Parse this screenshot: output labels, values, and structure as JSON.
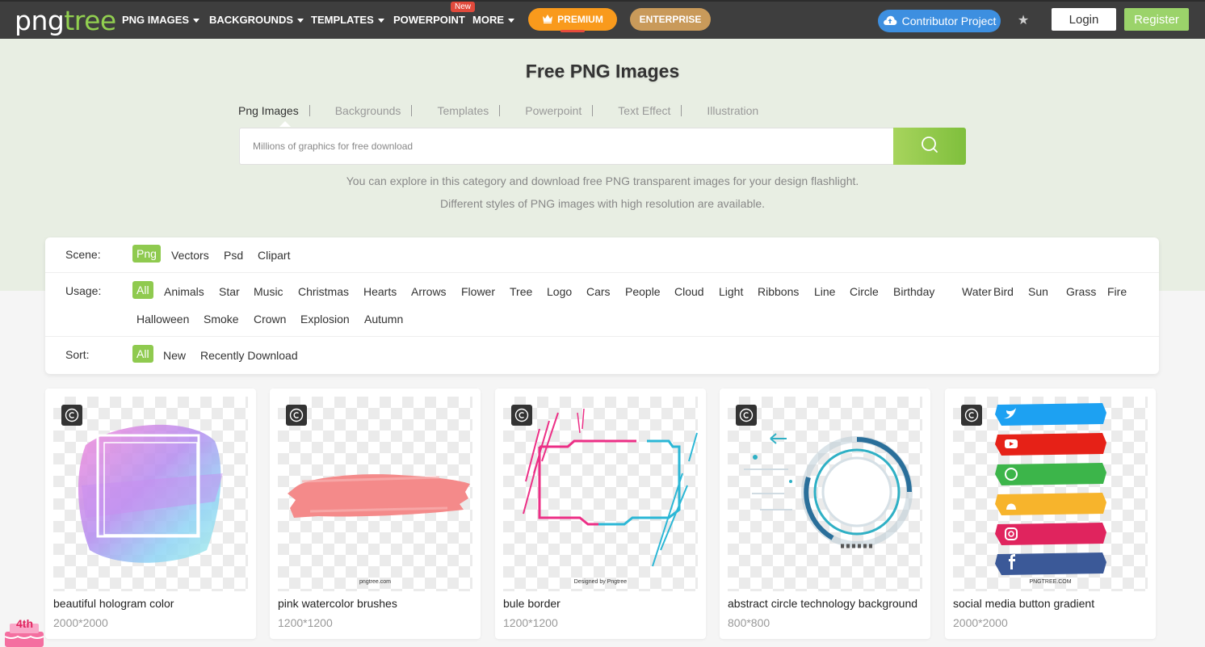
{
  "nav": {
    "logo_png": "png",
    "logo_tree": "tree",
    "items": [
      "PNG IMAGES",
      "BACKGROUNDS",
      "TEMPLATES",
      "POWERPOINT",
      "MORE"
    ],
    "new_badge": "New",
    "premium": "PREMIUM",
    "enterprise": "ENTERPRISE",
    "contributor": "Contributor Project",
    "login": "Login",
    "register": "Register"
  },
  "hero": {
    "title": "Free PNG Images",
    "tabs": [
      "Png Images",
      "Backgrounds",
      "Templates",
      "Powerpoint",
      "Text Effect",
      "Illustration"
    ],
    "search_placeholder": "Millions of graphics for free download",
    "desc1": "You can explore in this category and download free PNG transparent images for your design flashlight.",
    "desc2": "Different styles of PNG images with high resolution are available."
  },
  "filters": {
    "scene_label": "Scene:",
    "scene": [
      "Png",
      "Vectors",
      "Psd",
      "Clipart"
    ],
    "usage_label": "Usage:",
    "usage": [
      "All",
      "Animals",
      "Star",
      "Music",
      "Christmas",
      "Hearts",
      "Arrows",
      "Flower",
      "Tree",
      "Logo",
      "Cars",
      "People",
      "Cloud",
      "Light",
      "Ribbons",
      "Line",
      "Circle",
      "Birthday",
      "Water",
      "Bird",
      "Sun",
      "Grass",
      "Fire",
      "Halloween",
      "Smoke",
      "Crown",
      "Explosion",
      "Autumn"
    ],
    "sort_label": "Sort:",
    "sort": [
      "All",
      "New",
      "Recently Download"
    ]
  },
  "cards": [
    {
      "title": "beautiful hologram color",
      "size": "2000*2000",
      "watermark": ""
    },
    {
      "title": "pink watercolor brushes",
      "size": "1200*1200",
      "watermark": "pngtree.com"
    },
    {
      "title": "bule border",
      "size": "1200*1200",
      "watermark": "Designed by Pngtree"
    },
    {
      "title": "abstract circle technology background",
      "size": "800*800",
      "watermark": ""
    },
    {
      "title": "social media button gradient",
      "size": "2000*2000",
      "watermark": "PNGTREE.COM"
    }
  ],
  "colors": {
    "nav_bg": "#3e3e3e",
    "brand_green": "#8fca4f",
    "premium": "#f99a1c",
    "enterprise": "#c99a5a",
    "contributor": "#3d8fe0",
    "hero_bg": "#e8eee3"
  },
  "icons": {
    "premium": "crown-icon",
    "contributor": "cloud-upload-icon",
    "favorites": "star-icon",
    "search": "search-icon",
    "copyright": "copyright-icon"
  },
  "anniversary": "4th"
}
